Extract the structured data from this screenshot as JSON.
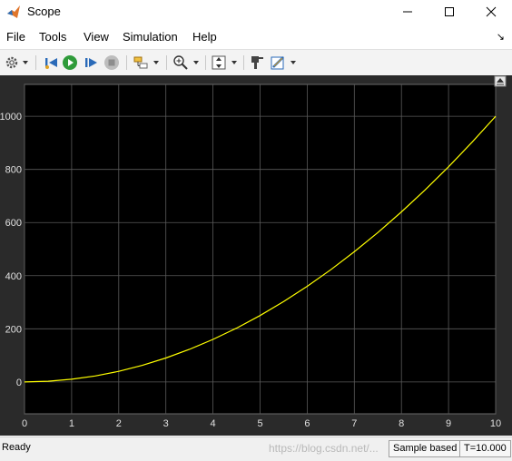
{
  "window": {
    "title": "Scope"
  },
  "menu": [
    "File",
    "Tools",
    "View",
    "Simulation",
    "Help"
  ],
  "toolbar_icons": [
    "settings-icon",
    "dropdown-icon",
    "step-back-icon",
    "run-icon",
    "step-forward-icon",
    "stop-icon",
    "highlight-block-icon",
    "dropdown-icon",
    "zoom-icon",
    "dropdown-icon",
    "autoscale-icon",
    "dropdown-icon",
    "style-icon",
    "measure-icon",
    "dropdown-icon"
  ],
  "plot_colors": {
    "background": "#000000",
    "frame": "#2a2a2a",
    "grid": "#5a5a5a",
    "line": "#ffff00",
    "tick": "#e0e0e0"
  },
  "chart_data": {
    "type": "line",
    "x_ticks": [
      0,
      1,
      2,
      3,
      4,
      5,
      6,
      7,
      8,
      9,
      10
    ],
    "y_ticks": [
      0,
      200,
      400,
      600,
      800,
      1000
    ],
    "xlim": [
      0,
      10
    ],
    "ylim": [
      -120,
      1120
    ],
    "grid": true,
    "series": [
      {
        "x": [
          0,
          0.5,
          1,
          1.5,
          2,
          2.5,
          3,
          3.5,
          4,
          4.5,
          5,
          5.5,
          6,
          6.5,
          7,
          7.5,
          8,
          8.5,
          9,
          9.5,
          10
        ],
        "y": [
          0,
          2.5,
          10,
          22.5,
          40,
          62.5,
          90,
          122.5,
          160,
          202.5,
          250,
          302.5,
          360,
          422.5,
          490,
          562.5,
          640,
          722.5,
          810,
          902.5,
          1000
        ],
        "color": "#ffff00"
      }
    ]
  },
  "status": {
    "ready": "Ready",
    "sample_mode": "Sample based",
    "time": "T=10.000",
    "watermark": "https://blog.csdn.net/..."
  }
}
